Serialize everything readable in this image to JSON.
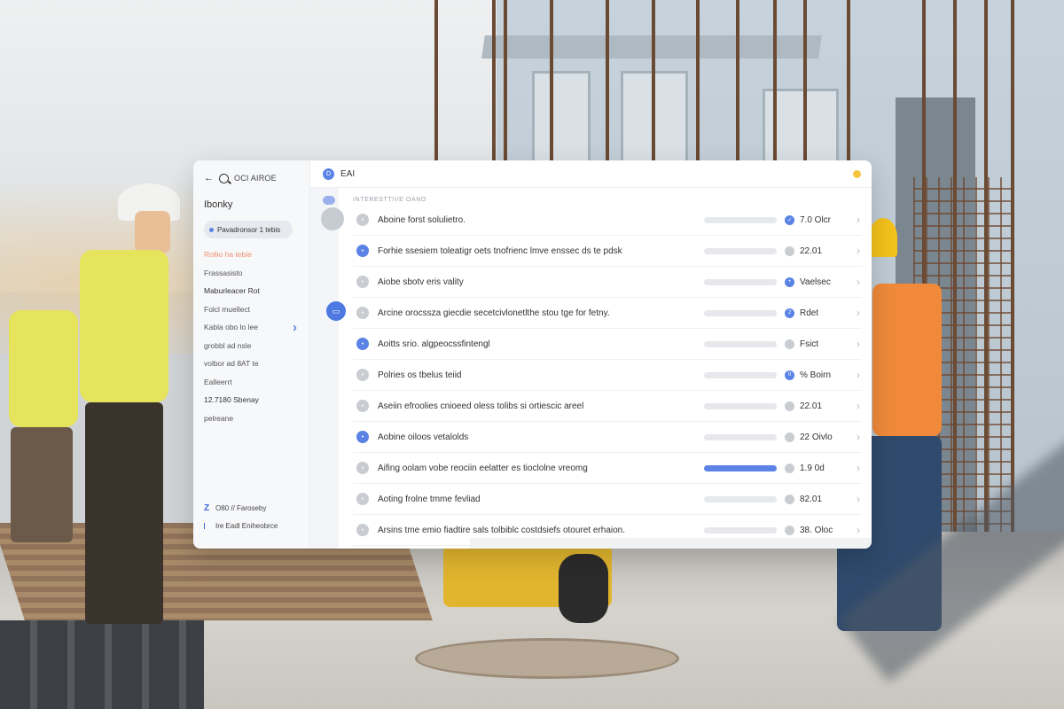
{
  "sidebar": {
    "top_label": "OCI AIROE",
    "heading": "Ibonky",
    "pill": "Pavadronsor 1 tebis",
    "items": [
      {
        "label": "Rollio ha tebie",
        "active": true
      },
      {
        "label": "Frassasisto",
        "active": false
      },
      {
        "label": "Maburleacer Rot",
        "active": false,
        "dark": true
      },
      {
        "label": "Folcl muellect",
        "active": false
      },
      {
        "label": "Kabla obo lo lee",
        "active": false
      },
      {
        "label": "grobbl ad nsle",
        "active": false
      },
      {
        "label": "volbor ad 8AT te",
        "active": false
      },
      {
        "label": "Ealleerrt",
        "active": false
      },
      {
        "label": "12.7180 Sbenay",
        "active": false,
        "dark": true
      },
      {
        "label": "pelreane",
        "active": false
      }
    ],
    "bottom": [
      {
        "icon": "z-logo-icon",
        "label": "O80 // Faroseby"
      },
      {
        "icon": "bookmark-icon",
        "label": "Ire Eadl Eniheobrce"
      }
    ]
  },
  "topbar": {
    "badge": "D",
    "title": "EAI"
  },
  "main": {
    "section_label": "INTERESTTIVE OANO",
    "rows": [
      {
        "text": "Aboine forst solulietro.",
        "icon_blue": false,
        "progress": 0,
        "status_icon_blue": true,
        "status_glyph": "✓",
        "value": "7.0 Olcr"
      },
      {
        "text": "Forhie ssesiem toleatigr oets tnofrienc lmve enssec ds te pdsk",
        "icon_blue": true,
        "progress": 0,
        "status_icon_blue": false,
        "status_glyph": "",
        "value": "22.01"
      },
      {
        "text": "Aiobe sbotv eris vality",
        "icon_blue": false,
        "progress": 0,
        "status_icon_blue": true,
        "status_glyph": "+",
        "value": "Vaelsec"
      },
      {
        "text": "Arcine orocssza giecdie secetcivlonetlthe stou tge for fetny.",
        "icon_blue": false,
        "progress": 0,
        "status_icon_blue": true,
        "status_glyph": "2",
        "value": "Rdet"
      },
      {
        "text": "Aoitts srio. algpeocssfintengl",
        "icon_blue": true,
        "progress": 0,
        "status_icon_blue": false,
        "status_glyph": "",
        "value": "Fsict"
      },
      {
        "text": "Polries os tbelus teiid",
        "icon_blue": false,
        "progress": 0,
        "status_icon_blue": true,
        "status_glyph": "0",
        "value": "% Boirn"
      },
      {
        "text": "Aseiin efroolies cnioeed oless tolibs si ortiescic areel",
        "icon_blue": false,
        "progress": 0,
        "status_icon_blue": false,
        "status_glyph": "",
        "value": "22.01"
      },
      {
        "text": "Aobine oiloos vetalolds",
        "icon_blue": true,
        "progress": 0,
        "status_icon_blue": false,
        "status_glyph": "",
        "value": "22 Oivlo"
      },
      {
        "text": "Aifing oolam vobe reociin eelatter es tioclolne vreomg",
        "icon_blue": false,
        "progress": 1.0,
        "status_icon_blue": false,
        "status_glyph": "",
        "value": "1.9 0d"
      },
      {
        "text": "Aoting frolne tmme fevliad",
        "icon_blue": false,
        "progress": 0,
        "status_icon_blue": false,
        "status_glyph": "",
        "value": "82.01"
      },
      {
        "text": "Arsins tme emio fiadtire sals tolbiblc costdsiefs otouret erhaion.",
        "icon_blue": false,
        "progress": 0,
        "status_icon_blue": false,
        "status_glyph": "",
        "value": "38. Oloc"
      }
    ]
  },
  "colors": {
    "accent": "#5b83e6",
    "active_item": "#ef8f6b",
    "status_dot": "#f5c542"
  }
}
